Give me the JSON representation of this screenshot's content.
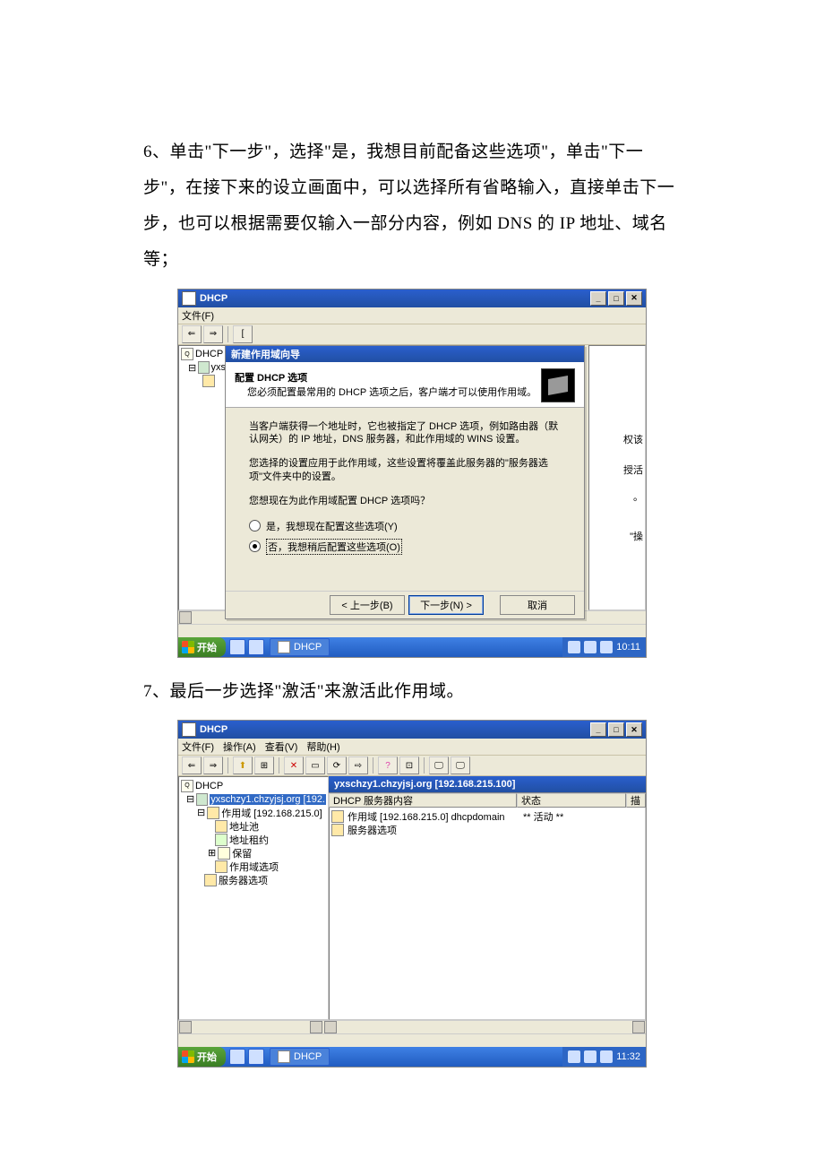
{
  "step6": {
    "text": "6、单击\"下一步\"，选择\"是，我想目前配备这些选项\"，单击\"下一步\"，在接下来的设立画面中，可以选择所有省略输入，直接单击下一步，也可以根据需要仅输入一部分内容，例如 DNS 的 IP 地址、域名等；"
  },
  "step7": {
    "text": "7、最后一步选择\"激活\"来激活此作用域。"
  },
  "s1": {
    "appTitle": "DHCP",
    "menu": {
      "file": "文件(F)"
    },
    "tree": {
      "root": "DHCP",
      "yxs": "yxs"
    },
    "wizard": {
      "title": "新建作用域向导",
      "headBold": "配置 DHCP 选项",
      "headSub": "您必须配置最常用的 DHCP 选项之后，客户端才可以使用作用域。",
      "p1": "当客户端获得一个地址时，它也被指定了 DHCP 选项，例如路由器（默认网关）的 IP 地址，DNS 服务器，和此作用域的 WINS 设置。",
      "p2": "您选择的设置应用于此作用域，这些设置将覆盖此服务器的\"服务器选项\"文件夹中的设置。",
      "p3": "您想现在为此作用域配置 DHCP 选项吗？",
      "radioYes": "是，我想现在配置这些选项(Y)",
      "radioNo": "否，我想稍后配置这些选项(O)",
      "back": "< 上一步(B)",
      "next": "下一步(N) >",
      "cancel": "取消"
    },
    "rightHints": {
      "a": "权该",
      "b": "授活",
      "d": "\"操"
    },
    "taskbar": {
      "start": "开始",
      "app": "DHCP",
      "time": "10:11"
    }
  },
  "s2": {
    "appTitle": "DHCP",
    "menu": {
      "file": "文件(F)",
      "action": "操作(A)",
      "view": "查看(V)",
      "help": "帮助(H)"
    },
    "tree": {
      "root": "DHCP",
      "server": "yxschzy1.chzyjsj.org [192.",
      "scope": "作用域 [192.168.215.0]",
      "pool": "地址池",
      "lease": "地址租约",
      "reserve": "保留",
      "scopeOpt": "作用域选项",
      "serverOpt": "服务器选项"
    },
    "header": "yxschzy1.chzyjsj.org [192.168.215.100]",
    "cols": {
      "c1": "DHCP 服务器内容",
      "c2": "状态",
      "c3": "描"
    },
    "rows": {
      "r1": {
        "name": "作用域 [192.168.215.0] dhcpdomain",
        "status": "** 活动 **"
      },
      "r2": {
        "name": "服务器选项",
        "status": ""
      }
    },
    "taskbar": {
      "start": "开始",
      "app": "DHCP",
      "time": "11:32"
    }
  }
}
